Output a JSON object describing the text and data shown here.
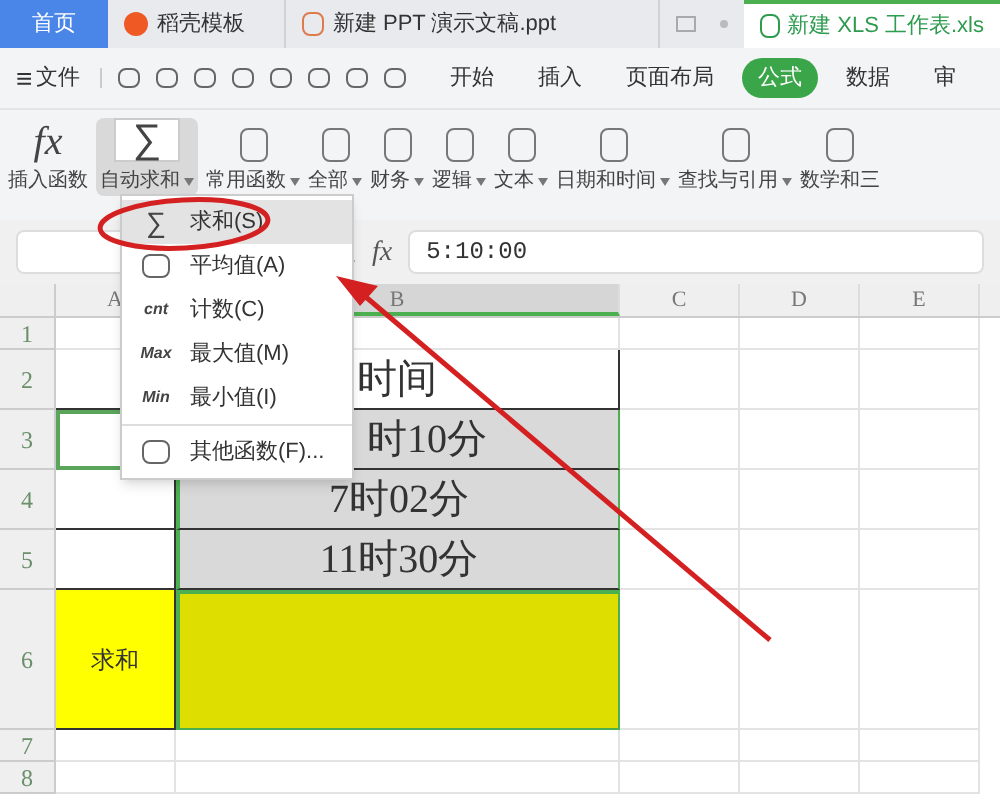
{
  "tabs": [
    {
      "label": "首页",
      "kind": "home",
      "selected": false
    },
    {
      "label": "稻壳模板",
      "kind": "docer",
      "selected": false
    },
    {
      "label": "新建 PPT 演示文稿.ppt",
      "kind": "ppt",
      "selected": false
    },
    {
      "label": "新建 XLS 工作表.xls",
      "kind": "xls",
      "selected": true
    }
  ],
  "menu": {
    "icon": "≡",
    "file": "文件",
    "items": [
      {
        "label": "开始",
        "selected": false
      },
      {
        "label": "插入",
        "selected": false
      },
      {
        "label": "页面布局",
        "selected": false
      },
      {
        "label": "公式",
        "selected": true
      },
      {
        "label": "数据",
        "selected": false
      },
      {
        "label": "审",
        "selected": false
      }
    ]
  },
  "ribbon": [
    {
      "label": "插入函数",
      "icon": "fx",
      "dropdown": false,
      "selected": false
    },
    {
      "label": "自动求和",
      "icon": "∑",
      "dropdown": true,
      "selected": true
    },
    {
      "label": "常用函数",
      "dropdown": true,
      "selected": false
    },
    {
      "label": "全部",
      "dropdown": true,
      "selected": false
    },
    {
      "label": "财务",
      "dropdown": true,
      "selected": false
    },
    {
      "label": "逻辑",
      "dropdown": true,
      "selected": false
    },
    {
      "label": "文本",
      "dropdown": true,
      "selected": false
    },
    {
      "label": "日期和时间",
      "dropdown": true,
      "selected": false
    },
    {
      "label": "查找与引用",
      "dropdown": true,
      "selected": false
    },
    {
      "label": "数学和三",
      "dropdown": false,
      "selected": false
    }
  ],
  "formula_bar": {
    "fx": "fx",
    "value": "5:10:00"
  },
  "columns": [
    "A",
    "B",
    "C",
    "D",
    "E"
  ],
  "rows": [
    {
      "number": "1",
      "a": "",
      "b": "",
      "kind": "blank"
    },
    {
      "number": "2",
      "a": "",
      "b": "时间",
      "kind": "header"
    },
    {
      "number": "3",
      "a": "",
      "b": "时10分",
      "kind": "time"
    },
    {
      "number": "4",
      "a": "",
      "b": "7时02分",
      "kind": "time"
    },
    {
      "number": "5",
      "a": "",
      "b": "11时30分",
      "kind": "time"
    },
    {
      "number": "6",
      "a": "求和",
      "b": "",
      "kind": "sum"
    },
    {
      "number": "7",
      "a": "",
      "b": "",
      "kind": "blank"
    },
    {
      "number": "8",
      "a": "",
      "b": "",
      "kind": "blank"
    }
  ],
  "dropdown": [
    {
      "icon": "∑",
      "label": "求和(S)",
      "selected": true
    },
    {
      "label": "平均值(A)",
      "selected": false
    },
    {
      "icon": "cnt",
      "label": "计数(C)",
      "selected": false
    },
    {
      "icon": "Max",
      "label": "最大值(M)",
      "selected": false
    },
    {
      "icon": "Min",
      "label": "最小值(I)",
      "selected": false
    },
    {
      "label": "其他函数(F)...",
      "selected": false
    }
  ]
}
